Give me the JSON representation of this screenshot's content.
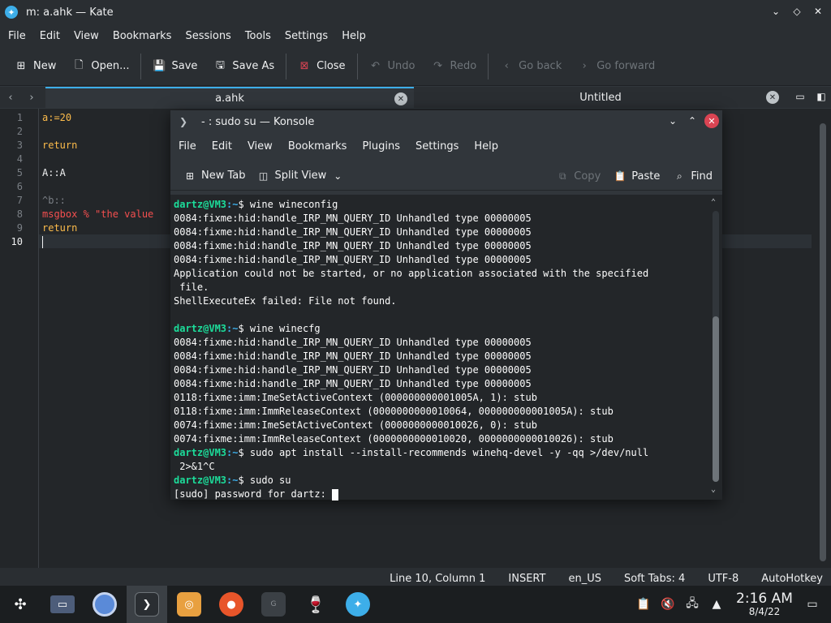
{
  "kate": {
    "title": "m: a.ahk — Kate",
    "menu": [
      "File",
      "Edit",
      "View",
      "Bookmarks",
      "Sessions",
      "Tools",
      "Settings",
      "Help"
    ],
    "toolbar": {
      "new": "New",
      "open": "Open...",
      "save": "Save",
      "save_as": "Save As",
      "close": "Close",
      "undo": "Undo",
      "redo": "Redo",
      "go_back": "Go back",
      "go_forward": "Go forward"
    },
    "tabs": [
      {
        "label": "a.ahk",
        "active": true
      },
      {
        "label": "Untitled",
        "active": false
      }
    ],
    "lines": [
      {
        "n": "1",
        "text": "a:=20"
      },
      {
        "n": "2",
        "text": ""
      },
      {
        "n": "3",
        "text": "return"
      },
      {
        "n": "4",
        "text": ""
      },
      {
        "n": "5",
        "text": "A::A"
      },
      {
        "n": "6",
        "text": ""
      },
      {
        "n": "7",
        "text": "^b::"
      },
      {
        "n": "8",
        "text": "msgbox % \"the value"
      },
      {
        "n": "9",
        "text": "return"
      },
      {
        "n": "10",
        "text": ""
      }
    ],
    "status": {
      "position": "Line 10, Column 1",
      "mode": "INSERT",
      "locale": "en_US",
      "indent": "Soft Tabs: 4",
      "encoding": "UTF-8",
      "syntax": "AutoHotkey"
    }
  },
  "konsole": {
    "title": "- : sudo su — Konsole",
    "menu": [
      "File",
      "Edit",
      "View",
      "Bookmarks",
      "Plugins",
      "Settings",
      "Help"
    ],
    "toolbar": {
      "new_tab": "New Tab",
      "split_view": "Split View",
      "copy": "Copy",
      "paste": "Paste",
      "find": "Find"
    },
    "prompt_user": "dartz@VM3",
    "prompt_path": ":~",
    "output": [
      {
        "type": "cmd",
        "cmd": "$ wine wineconfig"
      },
      {
        "type": "out",
        "text": "0084:fixme:hid:handle_IRP_MN_QUERY_ID Unhandled type 00000005"
      },
      {
        "type": "out",
        "text": "0084:fixme:hid:handle_IRP_MN_QUERY_ID Unhandled type 00000005"
      },
      {
        "type": "out",
        "text": "0084:fixme:hid:handle_IRP_MN_QUERY_ID Unhandled type 00000005"
      },
      {
        "type": "out",
        "text": "0084:fixme:hid:handle_IRP_MN_QUERY_ID Unhandled type 00000005"
      },
      {
        "type": "out",
        "text": "Application could not be started, or no application associated with the specified"
      },
      {
        "type": "out",
        "text": " file."
      },
      {
        "type": "out",
        "text": "ShellExecuteEx failed: File not found."
      },
      {
        "type": "out",
        "text": ""
      },
      {
        "type": "cmd",
        "cmd": "$ wine winecfg"
      },
      {
        "type": "out",
        "text": "0084:fixme:hid:handle_IRP_MN_QUERY_ID Unhandled type 00000005"
      },
      {
        "type": "out",
        "text": "0084:fixme:hid:handle_IRP_MN_QUERY_ID Unhandled type 00000005"
      },
      {
        "type": "out",
        "text": "0084:fixme:hid:handle_IRP_MN_QUERY_ID Unhandled type 00000005"
      },
      {
        "type": "out",
        "text": "0084:fixme:hid:handle_IRP_MN_QUERY_ID Unhandled type 00000005"
      },
      {
        "type": "out",
        "text": "0118:fixme:imm:ImeSetActiveContext (000000000001005A, 1): stub"
      },
      {
        "type": "out",
        "text": "0118:fixme:imm:ImmReleaseContext (0000000000010064, 000000000001005A): stub"
      },
      {
        "type": "out",
        "text": "0074:fixme:imm:ImeSetActiveContext (0000000000010026, 0): stub"
      },
      {
        "type": "out",
        "text": "0074:fixme:imm:ImmReleaseContext (0000000000010020, 0000000000010026): stub"
      },
      {
        "type": "cmd",
        "cmd": "$ sudo apt install --install-recommends winehq-devel -y -qq >/dev/null"
      },
      {
        "type": "out",
        "text": " 2>&1^C"
      },
      {
        "type": "cmd",
        "cmd": "$ sudo su"
      },
      {
        "type": "out",
        "text": "[sudo] password for dartz: "
      }
    ]
  },
  "taskbar": {
    "time": "2:16 AM",
    "date": "8/4/22",
    "apps": [
      "app-launcher",
      "file-manager",
      "chromium",
      "konsole",
      "marble",
      "firefox",
      "google-chrome",
      "wine",
      "kate"
    ]
  },
  "colors": {
    "accent": "#3daee9",
    "prompt_user": "#1cdc9a",
    "close_red": "#da4453"
  }
}
